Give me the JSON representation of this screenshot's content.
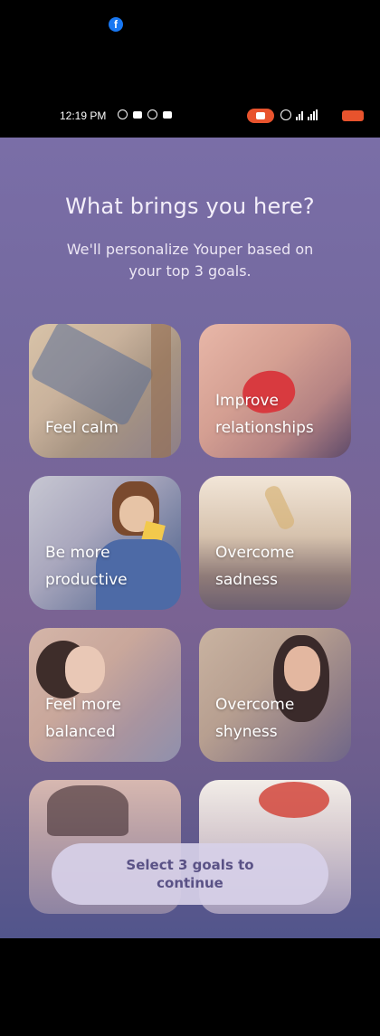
{
  "status_bar": {
    "time": "12:19 PM",
    "notification_icons": [
      "facebook-icon"
    ],
    "left_icons": [
      "whatsapp-icon",
      "video-icon",
      "facebook-icon",
      "video-icon"
    ],
    "right_icons": [
      "screen-record-icon",
      "alarm-icon",
      "signal-icon",
      "signal-icon",
      "battery-icon"
    ]
  },
  "header": {
    "title": "What brings you here?",
    "subtitle": "We'll personalize Youper based on your top 3 goals."
  },
  "goals": [
    {
      "label_line1": "Feel calm",
      "label_line2": ""
    },
    {
      "label_line1": "Improve",
      "label_line2": "relationships"
    },
    {
      "label_line1": "Be more",
      "label_line2": "productive"
    },
    {
      "label_line1": "Overcome",
      "label_line2": "sadness"
    },
    {
      "label_line1": "Feel more",
      "label_line2": "balanced"
    },
    {
      "label_line1": "Overcome",
      "label_line2": "shyness"
    },
    {
      "label_line1": "",
      "label_line2": ""
    },
    {
      "label_line1": "",
      "label_line2": ""
    }
  ],
  "cta": {
    "line1": "Select 3 goals to",
    "line2": "continue"
  },
  "colors": {
    "background_top": "#7a6ea7",
    "background_bottom": "#52558c",
    "button_bg": "#d7d0e8",
    "button_text": "#5a5286",
    "record_pill": "#e8532d"
  }
}
